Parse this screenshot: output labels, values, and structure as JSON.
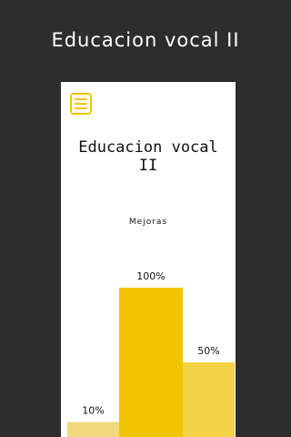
{
  "header": {
    "title": "Educacion vocal II"
  },
  "card": {
    "menu_icon": "hamburger-menu-icon",
    "title_line1": "Educacion vocal",
    "title_line2": "II",
    "section_label": "Mejoras"
  },
  "colors": {
    "background": "#2d2d2d",
    "card": "#ffffff",
    "accent": "#f2c400"
  },
  "chart_data": {
    "type": "bar",
    "categories": [
      "",
      "",
      ""
    ],
    "values": [
      10,
      100,
      50
    ],
    "value_labels": [
      "10%",
      "100%",
      "50%"
    ],
    "colors": [
      "#efd97c",
      "#f2c400",
      "#f3d244"
    ],
    "ylim": [
      0,
      100
    ],
    "grid": false,
    "legend": "none"
  }
}
